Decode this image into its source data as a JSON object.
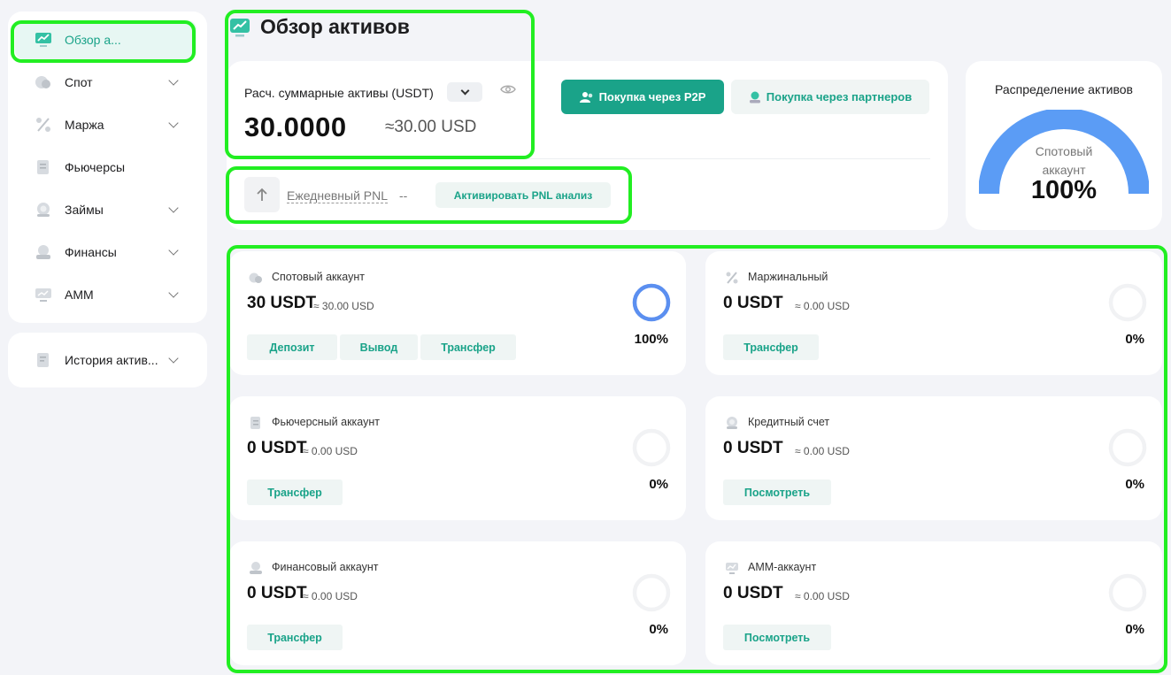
{
  "sidebar": {
    "items": [
      {
        "label": "Обзор а...",
        "icon": "chart-icon",
        "active": true,
        "expandable": false
      },
      {
        "label": "Спот",
        "icon": "coins-icon",
        "active": false,
        "expandable": true
      },
      {
        "label": "Маржа",
        "icon": "percent-icon",
        "active": false,
        "expandable": true
      },
      {
        "label": "Фьючерсы",
        "icon": "document-icon",
        "active": false,
        "expandable": false
      },
      {
        "label": "Займы",
        "icon": "loan-icon",
        "active": false,
        "expandable": true
      },
      {
        "label": "Финансы",
        "icon": "finance-icon",
        "active": false,
        "expandable": true
      },
      {
        "label": "AMM",
        "icon": "monitor-icon",
        "active": false,
        "expandable": true
      }
    ],
    "history": {
      "label": "История актив...",
      "icon": "history-icon"
    }
  },
  "header": {
    "title": "Обзор активов"
  },
  "total": {
    "label": "Расч. суммарные активы (USDT)",
    "value": "30.0000",
    "usd": "≈30.00 USD",
    "p2p_button": "Покупка через P2P",
    "partner_button": "Покупка через партнеров",
    "pnl_label": "Ежедневный PNL",
    "pnl_value": "--",
    "pnl_button": "Активировать PNL анализ"
  },
  "distribution": {
    "title": "Распределение активов",
    "sub_line1": "Спотовый",
    "sub_line2": "аккаунт",
    "percent": "100%"
  },
  "accounts": [
    {
      "name": "Спотовый аккаунт",
      "value": "30 USDT",
      "usd": "≈ 30.00 USD",
      "percent": "100%",
      "fill": 1.0,
      "buttons": [
        "Депозит",
        "Вывод",
        "Трансфер"
      ]
    },
    {
      "name": "Маржинальный",
      "value": "0 USDT",
      "usd": "≈ 0.00 USD",
      "percent": "0%",
      "fill": 0,
      "buttons": [
        "Трансфер"
      ]
    },
    {
      "name": "Фьючерсный аккаунт",
      "value": "0 USDT",
      "usd": "≈ 0.00 USD",
      "percent": "0%",
      "fill": 0,
      "buttons": [
        "Трансфер"
      ]
    },
    {
      "name": "Кредитный счет",
      "value": "0 USDT",
      "usd": "≈ 0.00 USD",
      "percent": "0%",
      "fill": 0,
      "buttons": [
        "Посмотреть"
      ]
    },
    {
      "name": "Финансовый аккаунт",
      "value": "0 USDT",
      "usd": "≈ 0.00 USD",
      "percent": "0%",
      "fill": 0,
      "buttons": [
        "Трансфер"
      ]
    },
    {
      "name": "AMM-аккаунт",
      "value": "0 USDT",
      "usd": "≈ 0.00 USD",
      "percent": "0%",
      "fill": 0,
      "buttons": [
        "Посмотреть"
      ]
    }
  ],
  "colors": {
    "accent": "#1aa389",
    "ring": "#5b8ff0",
    "highlight": "#22ee22"
  }
}
